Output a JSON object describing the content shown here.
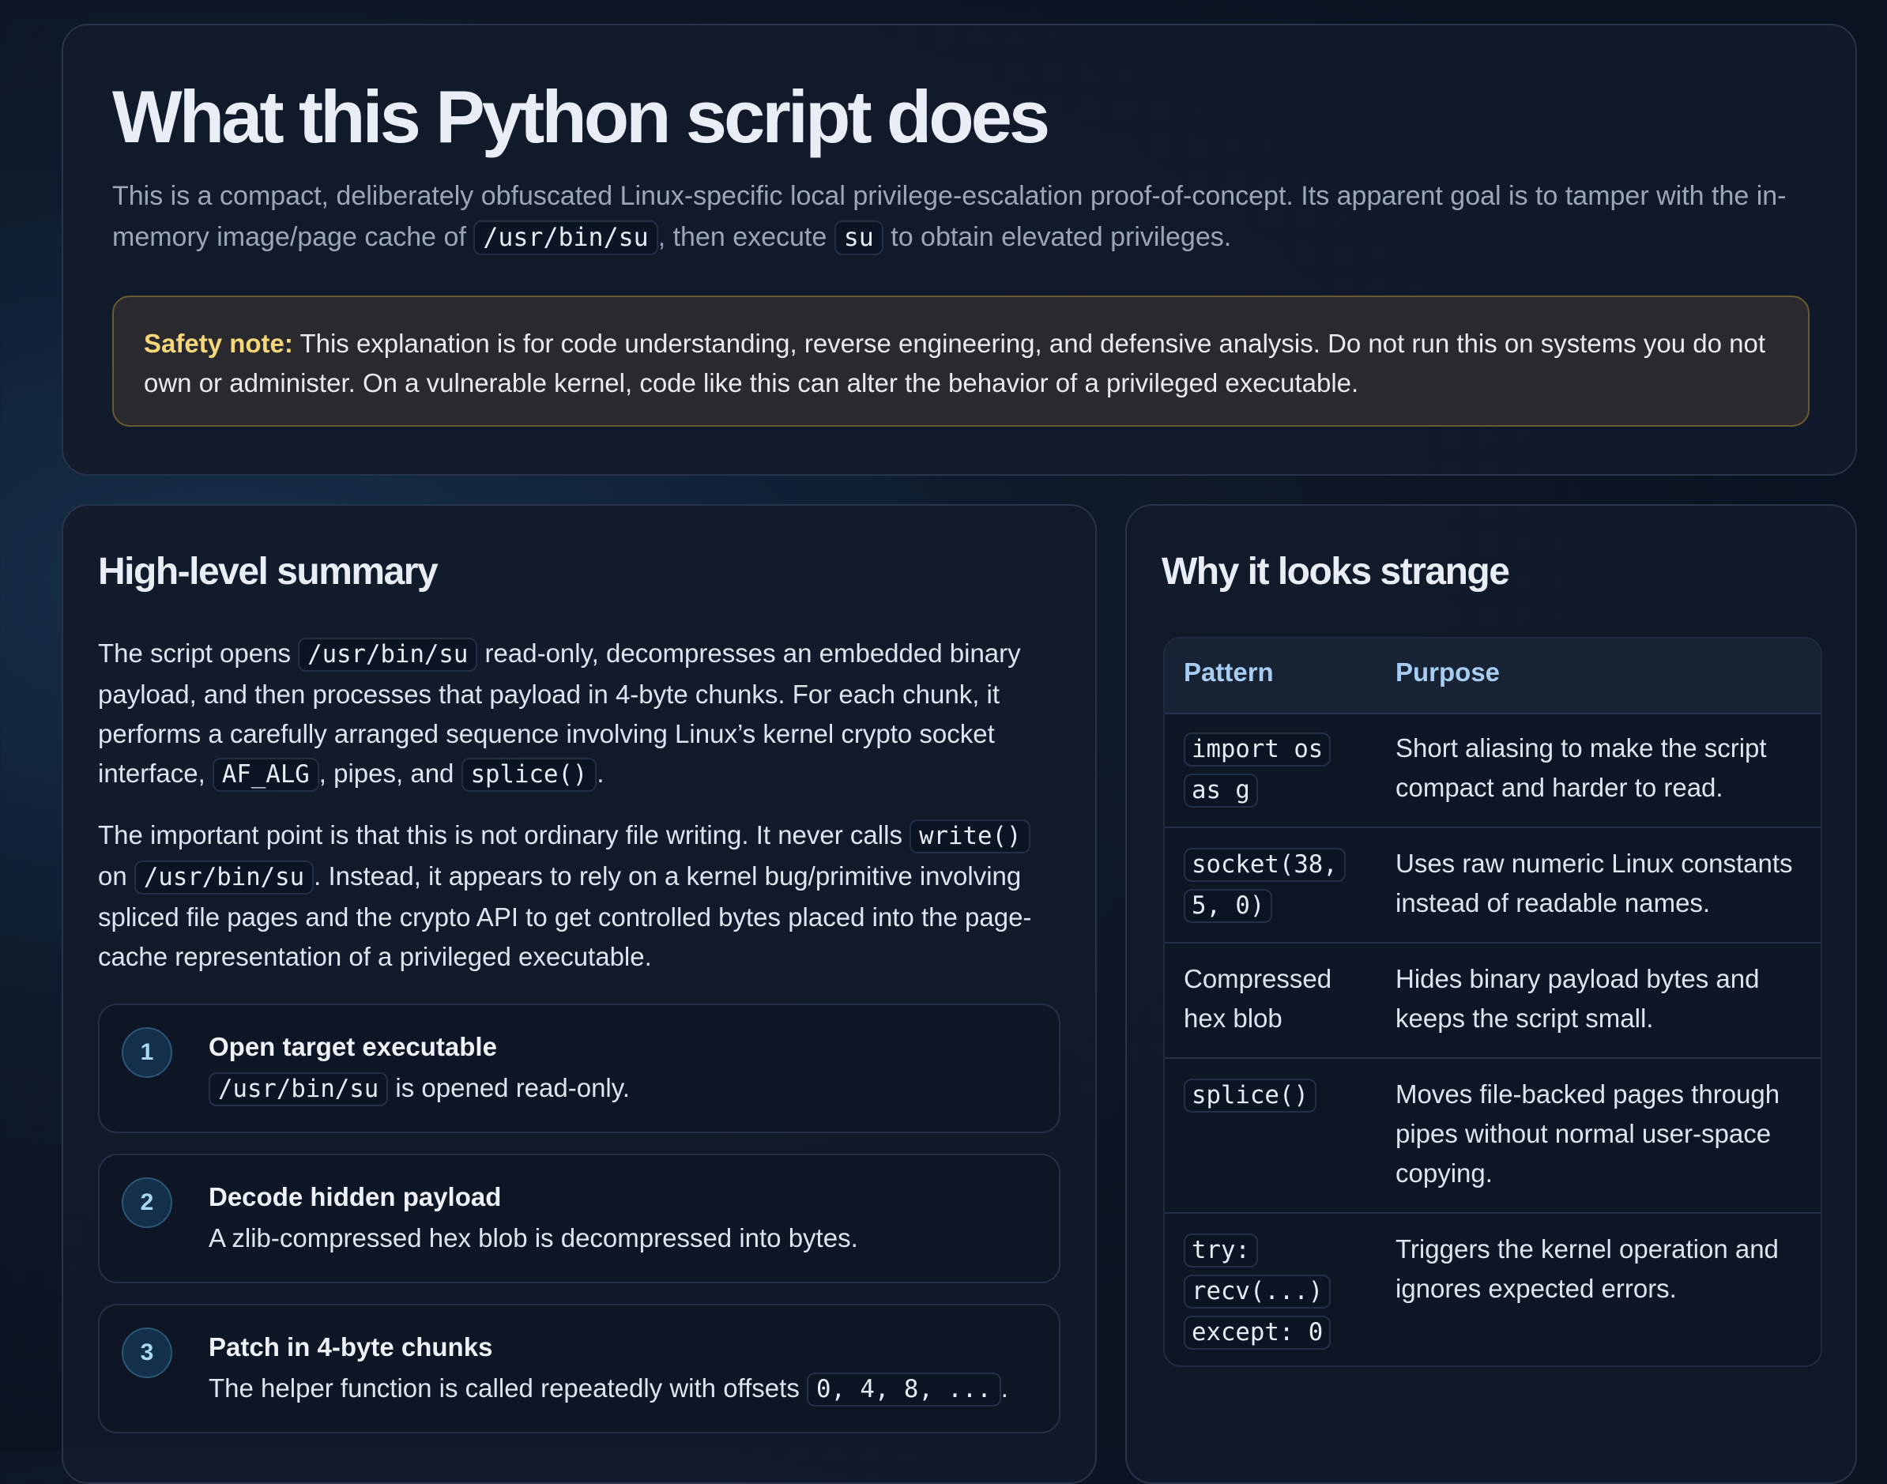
{
  "hero": {
    "title": "What this Python script does",
    "lead_1": "This is a compact, deliberately obfuscated Linux-specific local privilege-escalation proof-of-concept. Its apparent goal is to tamper with the in-memory image/page cache of ",
    "lead_code_1": "/usr/bin/su",
    "lead_2": ", then execute ",
    "lead_code_2": "su",
    "lead_3": " to obtain elevated privileges.",
    "safety_label": "Safety note:",
    "safety_text": " This explanation is for code understanding, reverse engineering, and defensive analysis. Do not run this on systems you do not own or administer. On a vulnerable kernel, code like this can alter the behavior of a privileged executable."
  },
  "summary": {
    "title": "High-level summary",
    "p1": {
      "t1": "The script opens ",
      "c1": "/usr/bin/su",
      "t2": " read-only, decompresses an embedded binary payload, and then processes that payload in 4-byte chunks. For each chunk, it performs a carefully arranged sequence involving Linux’s kernel crypto socket interface, ",
      "c2": "AF_ALG",
      "t3": ", pipes, and ",
      "c3": "splice()",
      "t4": "."
    },
    "p2": {
      "t1": "The important point is that this is not ordinary file writing. It never calls ",
      "c1": "write()",
      "t2": " on ",
      "c2": "/usr/bin/su",
      "t3": ". Instead, it appears to rely on a kernel bug/primitive involving spliced file pages and the crypto API to get controlled bytes placed into the page-cache representation of a privileged executable."
    },
    "steps": [
      {
        "num": "1",
        "title": "Open target executable",
        "code": "/usr/bin/su",
        "desc": " is opened read-only."
      },
      {
        "num": "2",
        "title": "Decode hidden payload",
        "desc": "A zlib-compressed hex blob is decompressed into bytes."
      },
      {
        "num": "3",
        "title": "Patch in 4-byte chunks",
        "desc": "The helper function is called repeatedly with offsets ",
        "code": "0, 4, 8, ...",
        "desc_end": "."
      }
    ]
  },
  "strange": {
    "title": "Why it looks strange",
    "col_pattern": "Pattern",
    "col_purpose": "Purpose",
    "rows": [
      {
        "pattern_code_1": "import os",
        "pattern_code_2": "as g",
        "purpose": "Short aliasing to make the script compact and harder to read."
      },
      {
        "pattern_code_1": "socket(38,",
        "pattern_code_2": "5, 0)",
        "purpose": "Uses raw numeric Linux constants instead of readable names."
      },
      {
        "pattern_text": "Compressed hex blob",
        "purpose": "Hides binary payload bytes and keeps the script small."
      },
      {
        "pattern_code_1": "splice()",
        "purpose": "Moves file-backed pages through pipes without normal user-space copying."
      },
      {
        "pattern_code_1": "try:",
        "pattern_code_2": "recv(...)",
        "pattern_code_3": "except: 0",
        "purpose": "Triggers the kernel operation and ignores expected errors."
      }
    ]
  }
}
